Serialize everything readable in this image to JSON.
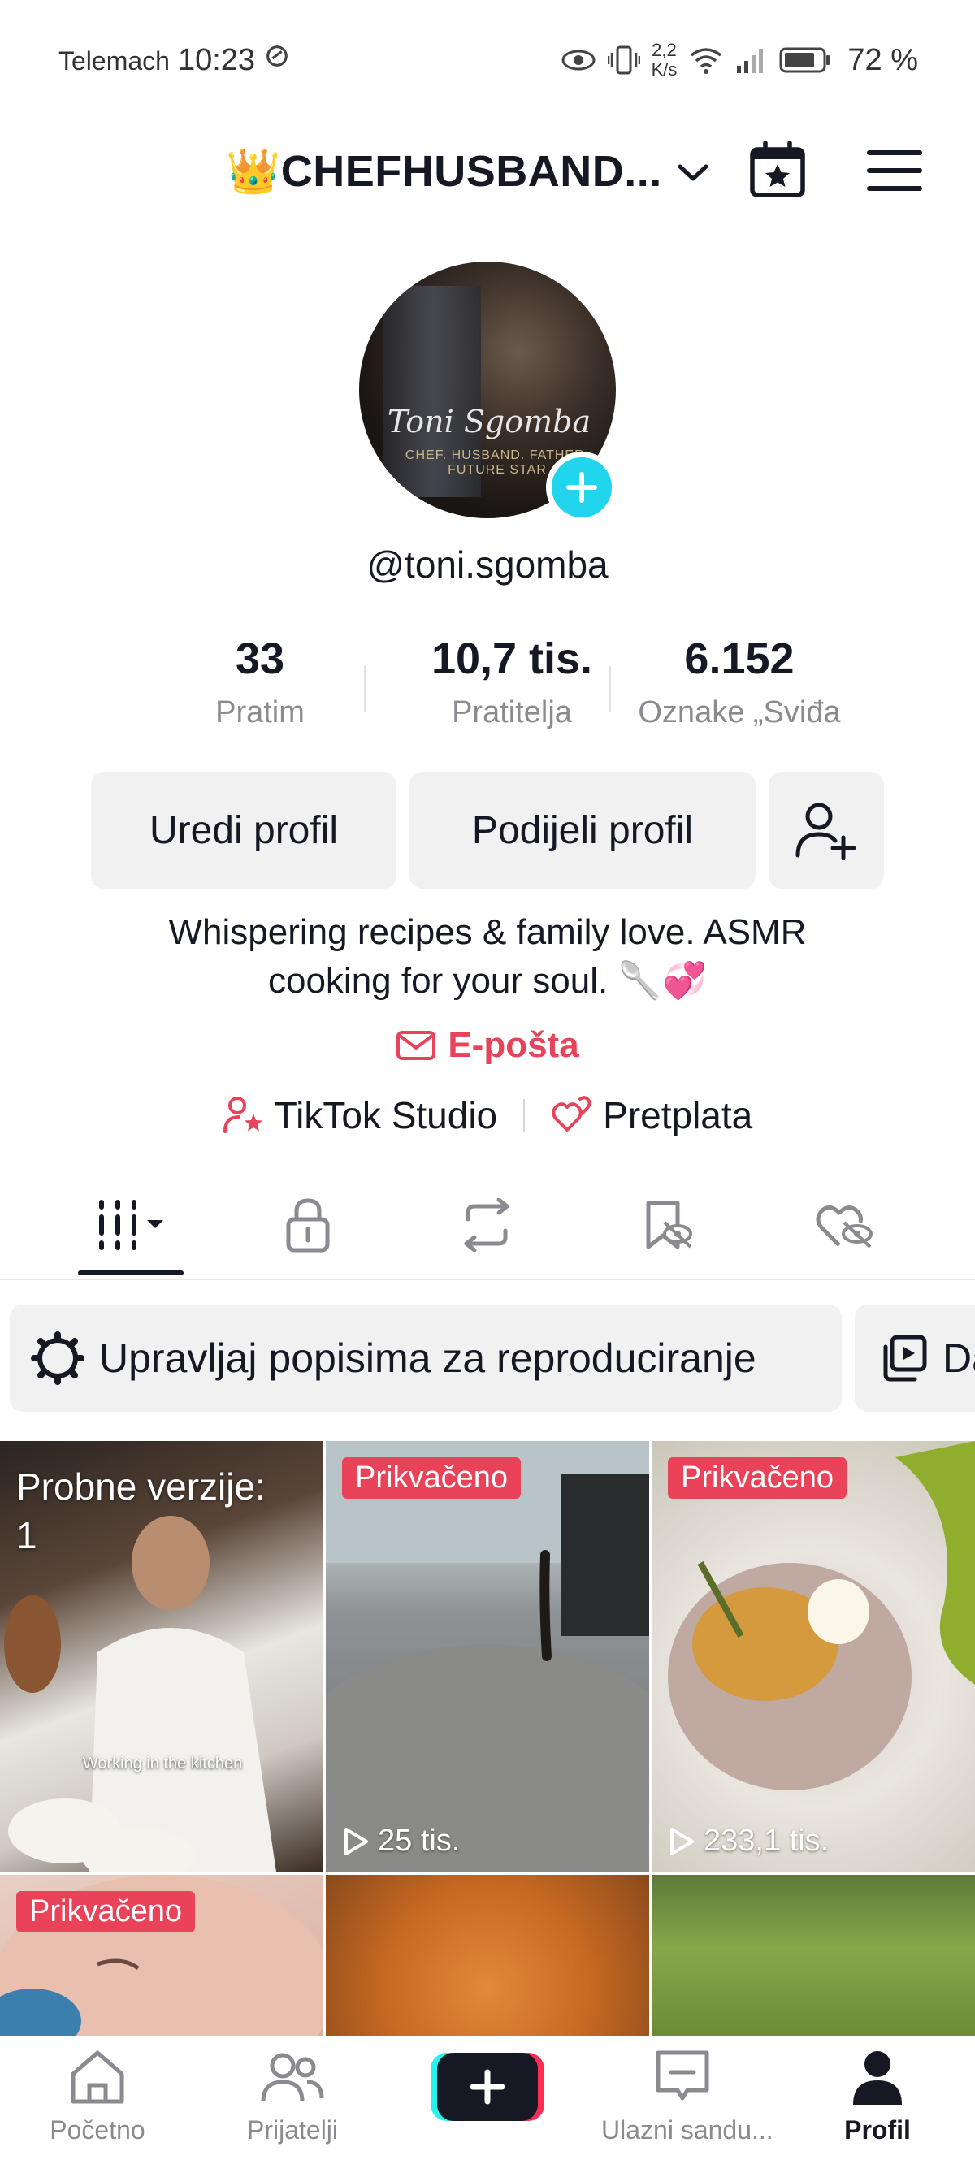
{
  "status_bar": {
    "carrier": "Telemach",
    "time": "10:23",
    "net_speed_value": "2,2",
    "net_speed_unit": "K/s",
    "battery": "72 %"
  },
  "header": {
    "username": "👑CHEFHUSBAND...",
    "icons": [
      "chevron-down-icon",
      "calendar-star-icon",
      "menu-icon"
    ]
  },
  "profile": {
    "avatar_signature": "Toni Sgomba",
    "avatar_subtitle": "CHEF. HUSBAND. FATHER. FUTURE STAR",
    "handle": "@toni.sgomba",
    "bio": "Whispering recipes & family love. ASMR cooking for your soul. 🥄💞",
    "email_label": "E-pošta"
  },
  "stats": [
    {
      "value": "33",
      "label": "Pratim"
    },
    {
      "value": "10,7 tis.",
      "label": "Pratitelja"
    },
    {
      "value": "6.152",
      "label": "Oznake „Sviđa"
    }
  ],
  "actions": {
    "edit_profile": "Uredi profil",
    "share_profile": "Podijeli profil"
  },
  "links": {
    "studio": "TikTok Studio",
    "subscription": "Pretplata"
  },
  "tabs": [
    "videos-grid-icon",
    "lock-icon",
    "repost-icon",
    "favorites-icon",
    "liked-icon"
  ],
  "playlists": {
    "manage": "Upravljaj popisima za reproduciranje",
    "second": "Da"
  },
  "videos": [
    {
      "draft_label": "Probne verzije:",
      "draft_count": "1",
      "caption": "Working in the kitchen"
    },
    {
      "badge": "Prikvačeno",
      "views": "25 tis."
    },
    {
      "badge": "Prikvačeno",
      "views": "233,1 tis."
    },
    {
      "badge": "Prikvačeno"
    },
    {},
    {}
  ],
  "bottom_nav": [
    {
      "label": "Početno",
      "icon": "home-icon"
    },
    {
      "label": "Prijatelji",
      "icon": "friends-icon"
    },
    {
      "label": "",
      "icon": "create-plus-icon"
    },
    {
      "label": "Ulazni sandu...",
      "icon": "inbox-icon"
    },
    {
      "label": "Profil",
      "icon": "profile-icon"
    }
  ],
  "colors": {
    "accent_red": "#ea4359",
    "link_red": "#e8435a",
    "cyan": "#20d5ec",
    "text": "#161823",
    "secondary_text": "#8a8b91"
  }
}
